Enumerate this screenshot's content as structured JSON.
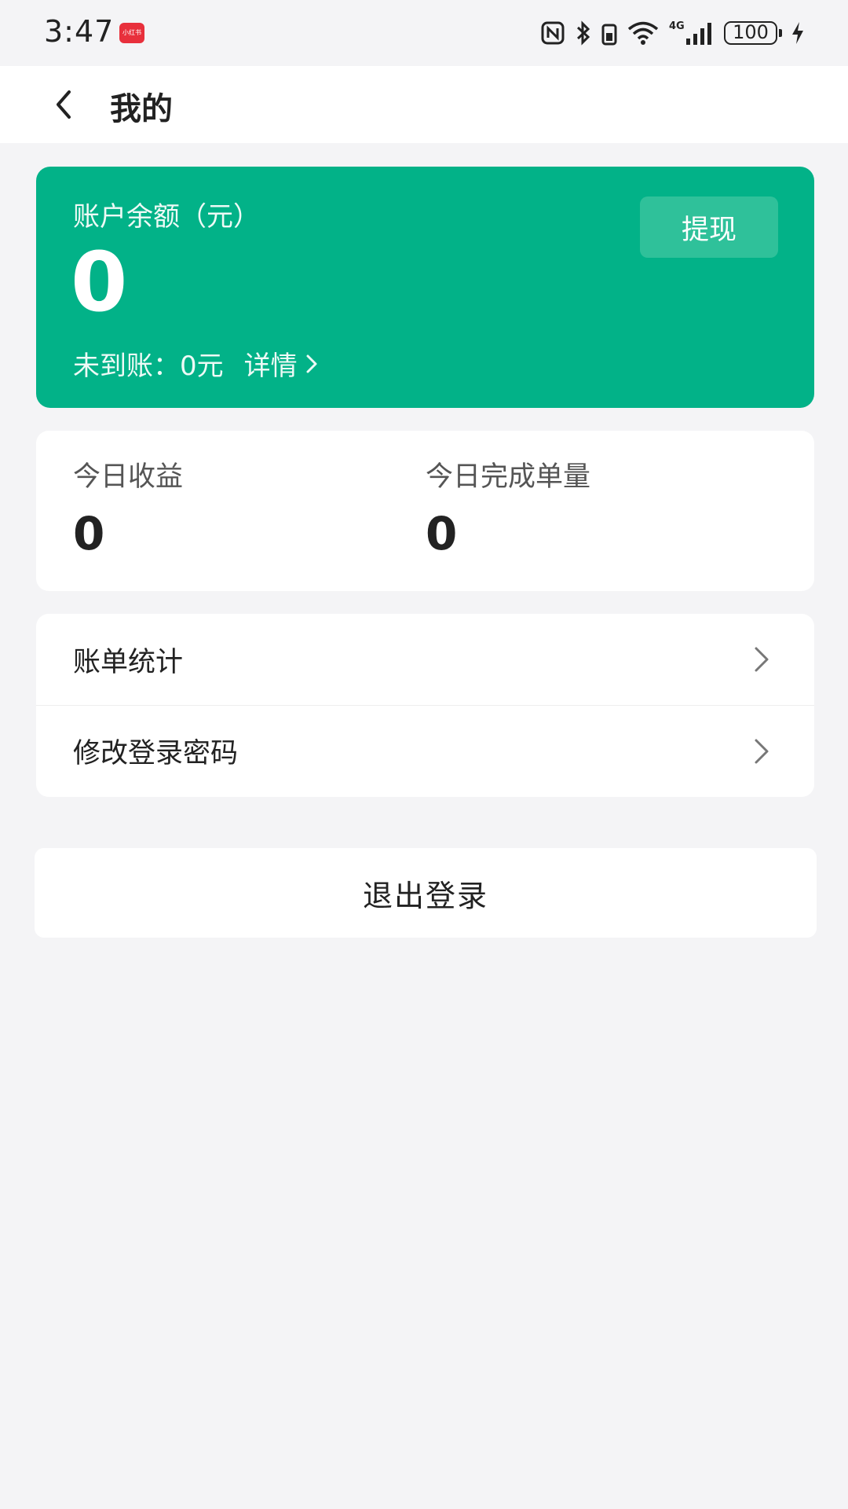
{
  "status_bar": {
    "time": "3:47",
    "app_badge": "小红书",
    "battery": "100",
    "network": "4G",
    "icons": [
      "nfc-icon",
      "bluetooth-icon",
      "wifi-icon",
      "signal-icon",
      "battery-icon",
      "charging-icon"
    ]
  },
  "nav": {
    "title": "我的",
    "back_icon": "chevron-left-icon"
  },
  "balance": {
    "label": "账户余额（元）",
    "value": "0",
    "withdraw_label": "提现",
    "pending_label": "未到账：",
    "pending_value": "0元",
    "detail_label": "详情"
  },
  "stats": {
    "today_income_label": "今日收益",
    "today_income_value": "0",
    "today_orders_label": "今日完成单量",
    "today_orders_value": "0"
  },
  "menu": {
    "items": [
      {
        "label": "账单统计"
      },
      {
        "label": "修改登录密码"
      }
    ]
  },
  "logout_label": "退出登录",
  "colors": {
    "accent": "#02b288",
    "background": "#f4f4f6",
    "card": "#ffffff"
  }
}
